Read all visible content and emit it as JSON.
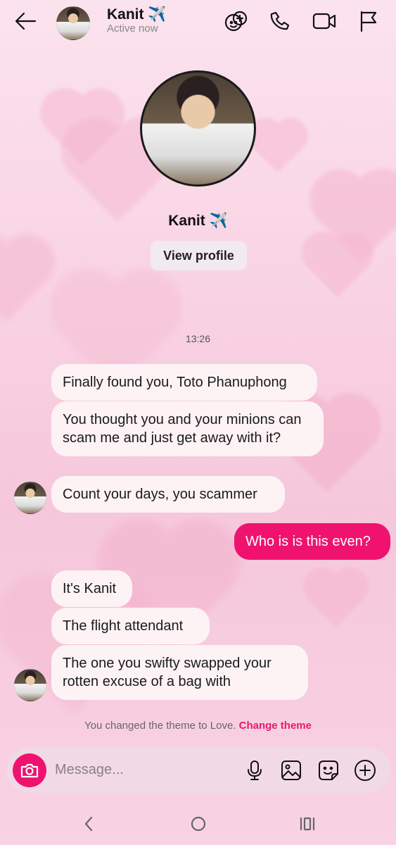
{
  "header": {
    "contact_name": "Kanit ✈️",
    "status": "Active now",
    "icons": [
      "back-arrow-icon",
      "effects-icon",
      "phone-icon",
      "video-icon",
      "flag-icon"
    ]
  },
  "profile": {
    "name": "Kanit ✈️",
    "view_profile_label": "View profile"
  },
  "timestamp": "13:26",
  "messages": [
    {
      "from": "them",
      "text": "Finally found you, Toto Phanuphong"
    },
    {
      "from": "them",
      "text": "You thought you and your minions can scam me and just get away with it?"
    },
    {
      "from": "them",
      "text": "Count your days, you scammer"
    },
    {
      "from": "me",
      "text": "Who is is this even?"
    },
    {
      "from": "them",
      "text": "It's Kanit"
    },
    {
      "from": "them",
      "text": "The flight attendant"
    },
    {
      "from": "them",
      "text": "The one you swifty swapped your rotten excuse of a bag with"
    }
  ],
  "theme_note": {
    "text": "You changed the theme to Love.",
    "link": "Change theme"
  },
  "composer": {
    "placeholder": "Message...",
    "icons": [
      "camera-icon",
      "microphone-icon",
      "gallery-icon",
      "sticker-icon",
      "add-icon"
    ]
  },
  "colors": {
    "accent": "#f0126f",
    "incoming_bubble": "#fdf3f5"
  }
}
